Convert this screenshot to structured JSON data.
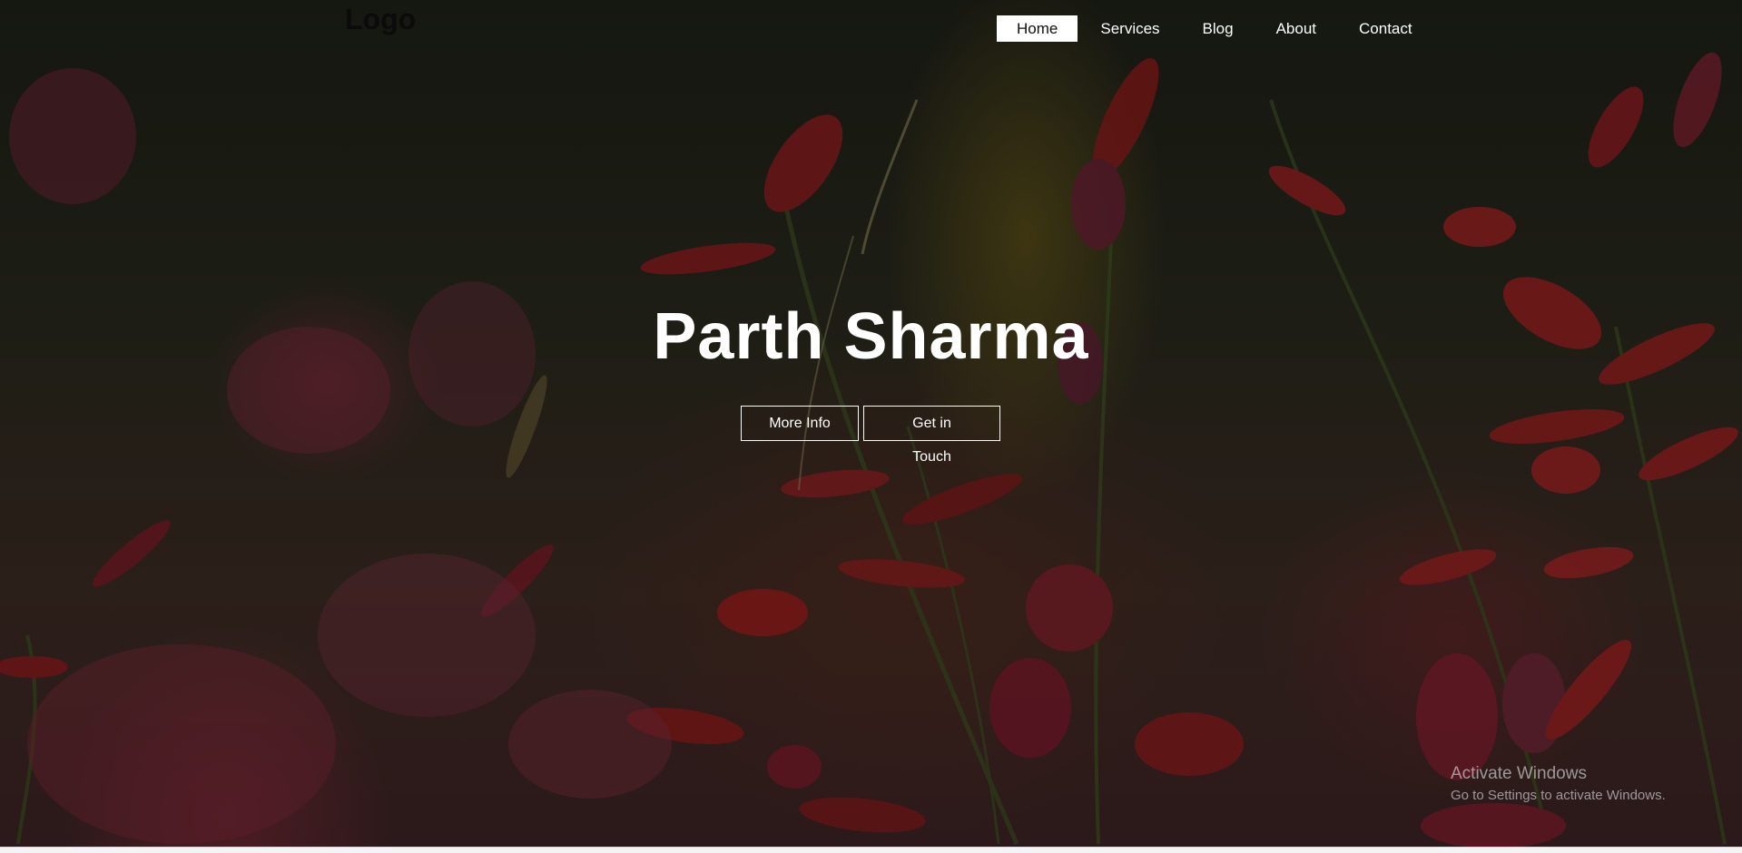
{
  "site": {
    "logo": "Logo",
    "hero_title": "Parth Sharma"
  },
  "nav": {
    "items": [
      {
        "label": "Home",
        "active": true
      },
      {
        "label": "Services",
        "active": false
      },
      {
        "label": "Blog",
        "active": false
      },
      {
        "label": "About",
        "active": false
      },
      {
        "label": "Contact",
        "active": false
      }
    ]
  },
  "buttons": {
    "more_info": "More Info",
    "get_in_touch": "Get in Touch"
  },
  "watermark": {
    "title": "Activate Windows",
    "subtitle": "Go to Settings to activate Windows."
  },
  "colors": {
    "text": "#ffffff",
    "nav_active_bg": "#ffffff",
    "logo": "#0b0b0b"
  }
}
